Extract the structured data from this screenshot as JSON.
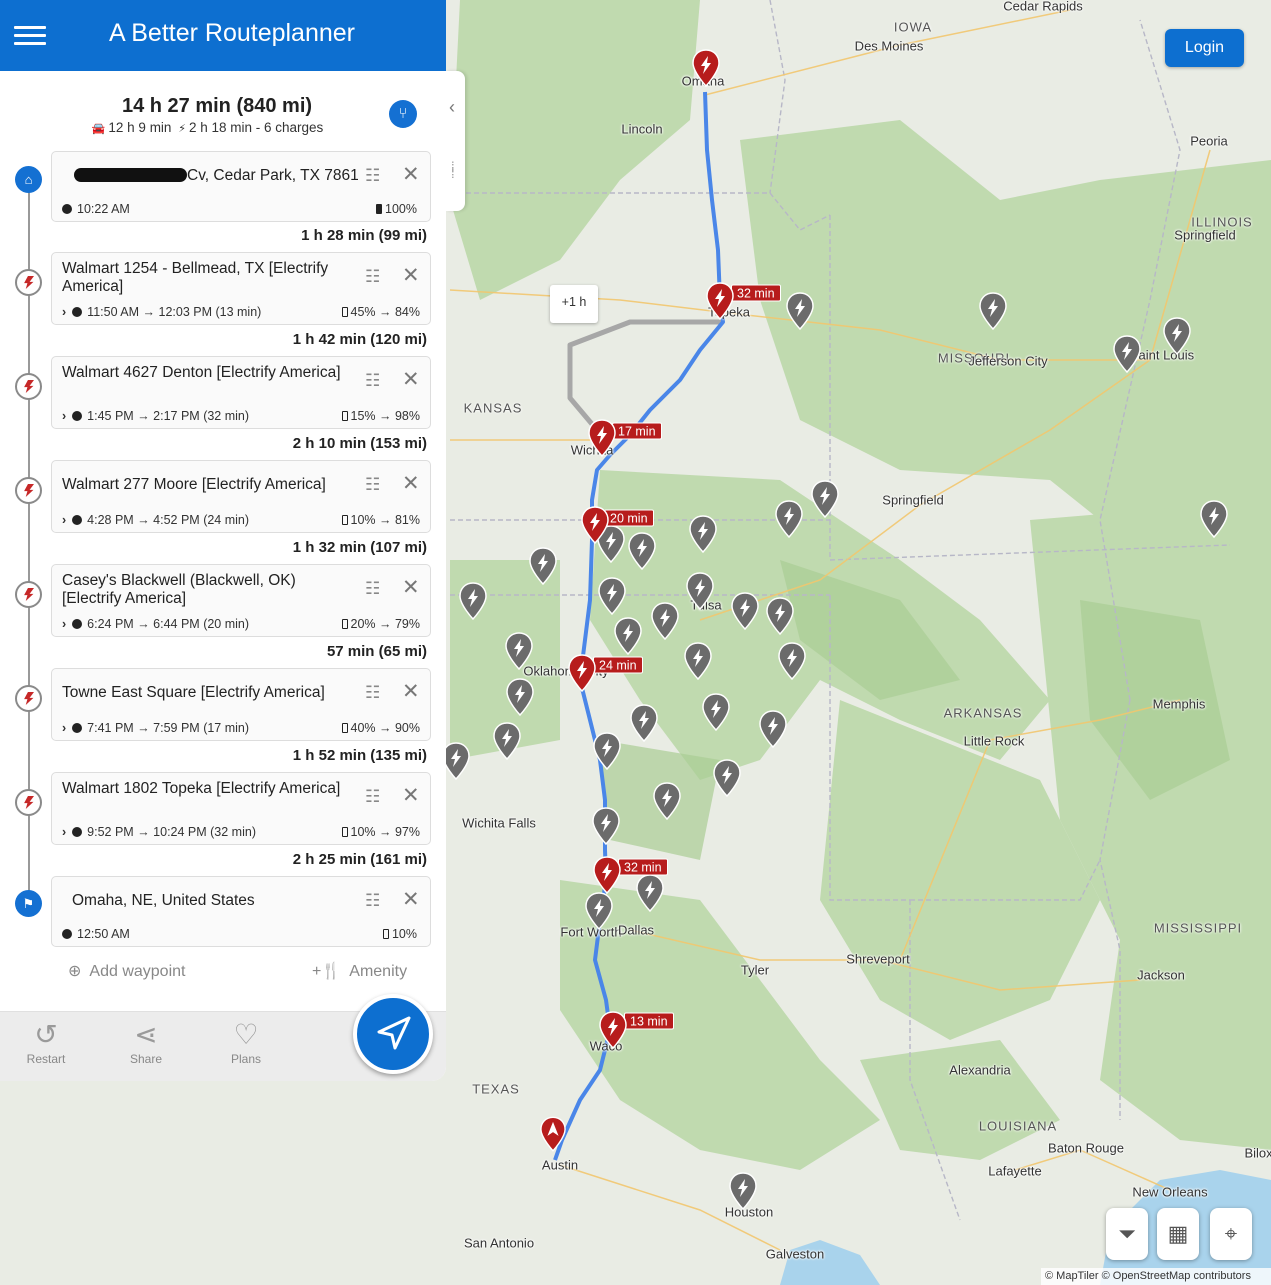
{
  "app": {
    "title": "A Better Routeplanner",
    "login_label": "Login"
  },
  "summary": {
    "total": "14 h 27 min (840 mi)",
    "drive": "12 h 9 min",
    "charge": "2 h 18 min - 6 charges"
  },
  "origin": {
    "name": "Cv, Cedar Park, TX 7861",
    "time": "10:22 AM",
    "soc": "100%"
  },
  "stops": [
    {
      "leg_before": "1 h 28 min (99 mi)",
      "name": "Walmart 1254 - Bellmead, TX [Electrify America]",
      "times": "11:50 AM → 12:03 PM (13 min)",
      "soc": "45% → 84%"
    },
    {
      "leg_before": "1 h 42 min (120 mi)",
      "name": "Walmart 4627 Denton [Electrify America]",
      "times": "1:45 PM → 2:17 PM (32 min)",
      "soc": "15% → 98%"
    },
    {
      "leg_before": "2 h 10 min (153 mi)",
      "name": "Walmart 277 Moore [Electrify America]",
      "times": "4:28 PM → 4:52 PM (24 min)",
      "soc": "10% → 81%"
    },
    {
      "leg_before": "1 h 32 min (107 mi)",
      "name": "Casey's Blackwell (Blackwell, OK) [Electrify America]",
      "times": "6:24 PM → 6:44 PM (20 min)",
      "soc": "20% → 79%"
    },
    {
      "leg_before": "57 min (65 mi)",
      "name": "Towne East Square [Electrify America]",
      "times": "7:41 PM → 7:59 PM (17 min)",
      "soc": "40% → 90%"
    },
    {
      "leg_before": "1 h 52 min (135 mi)",
      "name": "Walmart 1802 Topeka [Electrify America]",
      "times": "9:52 PM → 10:24 PM (32 min)",
      "soc": "10% → 97%"
    }
  ],
  "destination": {
    "leg_before": "2 h 25 min (161 mi)",
    "name": "Omaha, NE, United States",
    "time": "12:50 AM",
    "soc": "10%"
  },
  "actions": {
    "add_waypoint": "Add waypoint",
    "amenity": "Amenity",
    "restart": "Restart",
    "share": "Share",
    "plans": "Plans"
  },
  "map": {
    "alt_route_label": "+1 h",
    "stop_tags": [
      "32 min",
      "17 min",
      "20 min",
      "24 min",
      "32 min",
      "13 min"
    ],
    "cities": [
      "Cedar Rapids",
      "Des Moines",
      "Omaha",
      "Lincoln",
      "Peoria",
      "Springfield",
      "Topeka",
      "Jefferson City",
      "Saint Louis",
      "Wichita",
      "Springfield",
      "Tulsa",
      "Oklahoma City",
      "Memphis",
      "Little Rock",
      "Wichita Falls",
      "Fort Worth",
      "Dallas",
      "Tyler",
      "Shreveport",
      "Jackson",
      "Waco",
      "Alexandria",
      "Baton Rouge",
      "Lafayette",
      "New Orleans",
      "Austin",
      "Houston",
      "San Antonio",
      "Galveston",
      "Biloxi"
    ],
    "states": [
      "IOWA",
      "ILLINOIS",
      "MISSOURI",
      "KANSAS",
      "ARKANSAS",
      "MISSISSIPPI",
      "TEXAS",
      "LOUISIANA"
    ],
    "attribution": "© MapTiler © OpenStreetMap contributors"
  },
  "colors": {
    "accent": "#0d6fd0",
    "route": "#4a86e8",
    "stop_marker": "#b71c1c",
    "charger_marker": "#666666"
  }
}
